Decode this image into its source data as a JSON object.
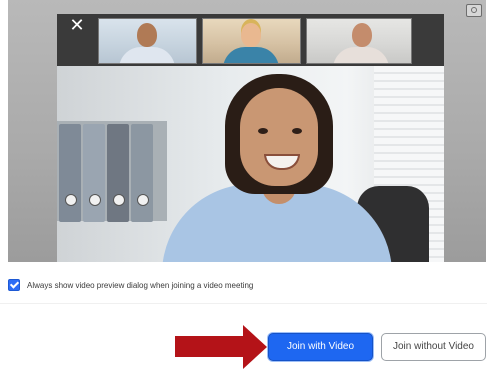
{
  "dialog": {
    "close_icon": "close-icon",
    "corner_icon": "camera-settings-icon"
  },
  "preview": {
    "participants": [
      {
        "name": "participant-thumbnail-1"
      },
      {
        "name": "participant-thumbnail-2"
      },
      {
        "name": "participant-thumbnail-3"
      }
    ]
  },
  "options": {
    "checkbox_label": "Always show video preview dialog when joining a video meeting",
    "checkbox_checked": true
  },
  "actions": {
    "join_with_video": "Join with Video",
    "join_without_video": "Join without Video"
  },
  "colors": {
    "primary": "#1e67f1",
    "arrow": "#b41318"
  }
}
